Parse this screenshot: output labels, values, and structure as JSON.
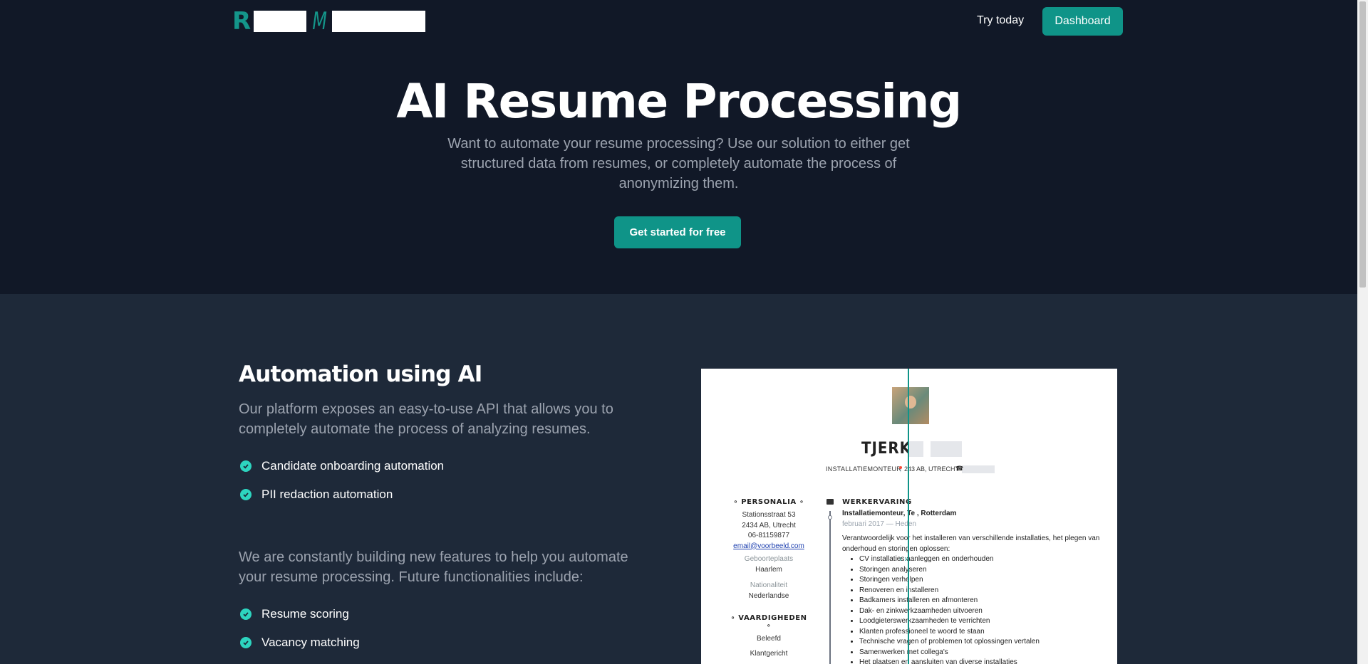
{
  "header": {
    "logo_letters": [
      "R",
      "M"
    ],
    "nav": {
      "try_label": "Try today",
      "dashboard_label": "Dashboard"
    }
  },
  "hero": {
    "title": "AI Resume Processing",
    "subtitle": "Want to automate your resume processing? Use our solution to either get structured data from resumes, or completely automate the process of anonymizing them.",
    "cta_label": "Get started for free"
  },
  "features": {
    "title": "Automation using AI",
    "intro": "Our platform exposes an easy-to-use API that allows you to completely automate the process of analyzing resumes.",
    "items": [
      "Candidate onboarding automation",
      "PII redaction automation"
    ],
    "future_intro": "We are constantly building new features to help you automate your resume processing. Future functionalities include:",
    "future_items": [
      "Resume scoring",
      "Vacancy matching"
    ]
  },
  "resume": {
    "name": "TJERK",
    "role": "INSTALLATIEMONTEUR",
    "address": "243  AB, UTRECHT",
    "personalia": {
      "heading": "PERSONALIA",
      "street": "Stationsstraat 53",
      "postal": "2434 AB, Utrecht",
      "phone": "06-81159877",
      "email": "email@voorbeeld.com",
      "birthplace_label": "Geboorteplaats",
      "birthplace": "Haarlem",
      "nationality_label": "Nationaliteit",
      "nationality": "Nederlandse"
    },
    "skills": {
      "heading": "VAARDIGHEDEN",
      "items": [
        "Beleefd",
        "Klantgericht"
      ]
    },
    "experience": {
      "heading": "WERKERVARING",
      "job_title": "Installatiemonteur, Te      , Rotterdam",
      "dates": "februari 2017 — Heden",
      "description": "Verantwoordelijk voor het installeren van verschillende installaties, het plegen van onderhoud en storingen oplossen:",
      "bullets": [
        "CV installaties aanleggen en onderhouden",
        "Storingen analyseren",
        "Storingen verhelpen",
        "Renoveren en installeren",
        "Badkamers installeren en afmonteren",
        "Dak- en zinkwerkzaamheden uitvoeren",
        "Loodgieterswerkzaamheden te verrichten",
        "Klanten professioneel te woord te staan",
        "Technische vragen of problemen tot oplossingen vertalen",
        "Samenwerken met collega's",
        "Het plaatsen en aansluiten van diverse installaties"
      ]
    }
  },
  "colors": {
    "accent": "#0f9488",
    "check": "#2dd4bf",
    "hero_bg": "#111827",
    "section_bg": "#1e2939"
  }
}
